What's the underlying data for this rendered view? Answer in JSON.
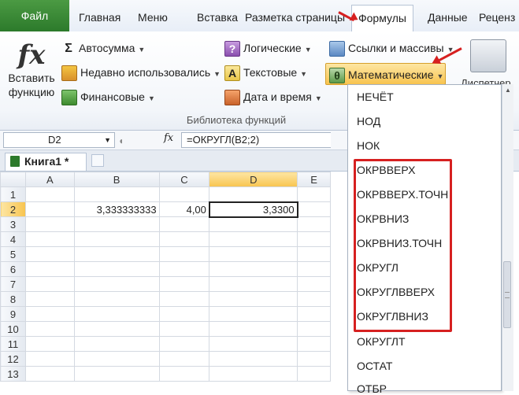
{
  "tabs": {
    "file": "Файл",
    "items": [
      "Главная",
      "Меню",
      "Вставка",
      "Разметка страницы",
      "Формулы",
      "Данные",
      "Реценз"
    ],
    "active": "Формулы"
  },
  "ribbon": {
    "insert_function": {
      "line1": "Вставить",
      "line2": "функцию",
      "icon": "fx-icon"
    },
    "autosum": "Автосумма",
    "recent": "Недавно использовались",
    "financial": "Финансовые",
    "logical": "Логические",
    "text": "Текстовые",
    "datetime": "Дата и время",
    "lookup": "Ссылки и массивы",
    "math": "Математические",
    "dispatcher": "Диспетчер",
    "group_label": "Библиотека функций"
  },
  "formula_bar": {
    "name_box": "D2",
    "fx": "fx",
    "formula": "=ОКРУГЛ(B2;2)"
  },
  "workbook": {
    "tab": "Книга1 *"
  },
  "sheet": {
    "columns": [
      "A",
      "B",
      "C",
      "D",
      "E"
    ],
    "rows": [
      "1",
      "2",
      "3",
      "4",
      "5",
      "6",
      "7",
      "8",
      "9",
      "10",
      "11",
      "12",
      "13"
    ],
    "cells": {
      "B2": "3,333333333",
      "C2": "4,00",
      "D2": "3,3300"
    }
  },
  "menu": {
    "items": [
      "НЕЧЁТ",
      "НОД",
      "НОК",
      "ОКРВВЕРХ",
      "ОКРВВЕРХ.ТОЧН",
      "ОКРВНИЗ",
      "ОКРВНИЗ.ТОЧН",
      "ОКРУГЛ",
      "ОКРУГЛВВЕРХ",
      "ОКРУГЛВНИЗ",
      "ОКРУГЛТ",
      "ОСТАТ",
      "ОТБР"
    ],
    "highlighted": [
      "ОКРВВЕРХ",
      "ОКРВВЕРХ.ТОЧН",
      "ОКРВНИЗ",
      "ОКРВНИЗ.ТОЧН",
      "ОКРУГЛ",
      "ОКРУГЛВВЕРХ",
      "ОКРУГЛВНИЗ"
    ]
  },
  "colors": {
    "file_tab": "#2c7a2b",
    "highlight": "#d62020",
    "math_button": "#f8c44f"
  }
}
